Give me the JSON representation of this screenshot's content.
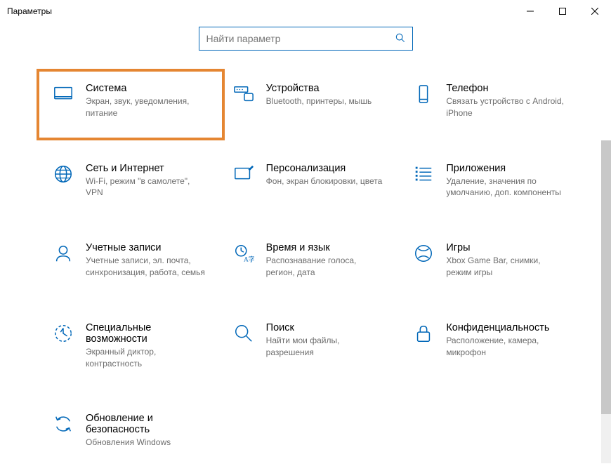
{
  "window": {
    "title": "Параметры"
  },
  "search": {
    "placeholder": "Найти параметр"
  },
  "tiles": {
    "system": {
      "title": "Система",
      "desc": "Экран, звук, уведомления, питание"
    },
    "devices": {
      "title": "Устройства",
      "desc": "Bluetooth, принтеры, мышь"
    },
    "phone": {
      "title": "Телефон",
      "desc": "Связать устройство с Android, iPhone"
    },
    "network": {
      "title": "Сеть и Интернет",
      "desc": "Wi-Fi, режим \"в самолете\", VPN"
    },
    "personalization": {
      "title": "Персонализация",
      "desc": "Фон, экран блокировки, цвета"
    },
    "apps": {
      "title": "Приложения",
      "desc": "Удаление, значения по умолчанию, доп. компоненты"
    },
    "accounts": {
      "title": "Учетные записи",
      "desc": "Учетные записи, эл. почта, синхронизация, работа, семья"
    },
    "time": {
      "title": "Время и язык",
      "desc": "Распознавание голоса, регион, дата"
    },
    "gaming": {
      "title": "Игры",
      "desc": "Xbox Game Bar, снимки, режим игры"
    },
    "accessibility": {
      "title": "Специальные возможности",
      "desc": "Экранный диктор, контрастность"
    },
    "searchcat": {
      "title": "Поиск",
      "desc": "Найти мои файлы, разрешения"
    },
    "privacy": {
      "title": "Конфиденциальность",
      "desc": "Расположение, камера, микрофон"
    },
    "update": {
      "title": "Обновление и безопасность",
      "desc": "Обновления Windows"
    }
  }
}
